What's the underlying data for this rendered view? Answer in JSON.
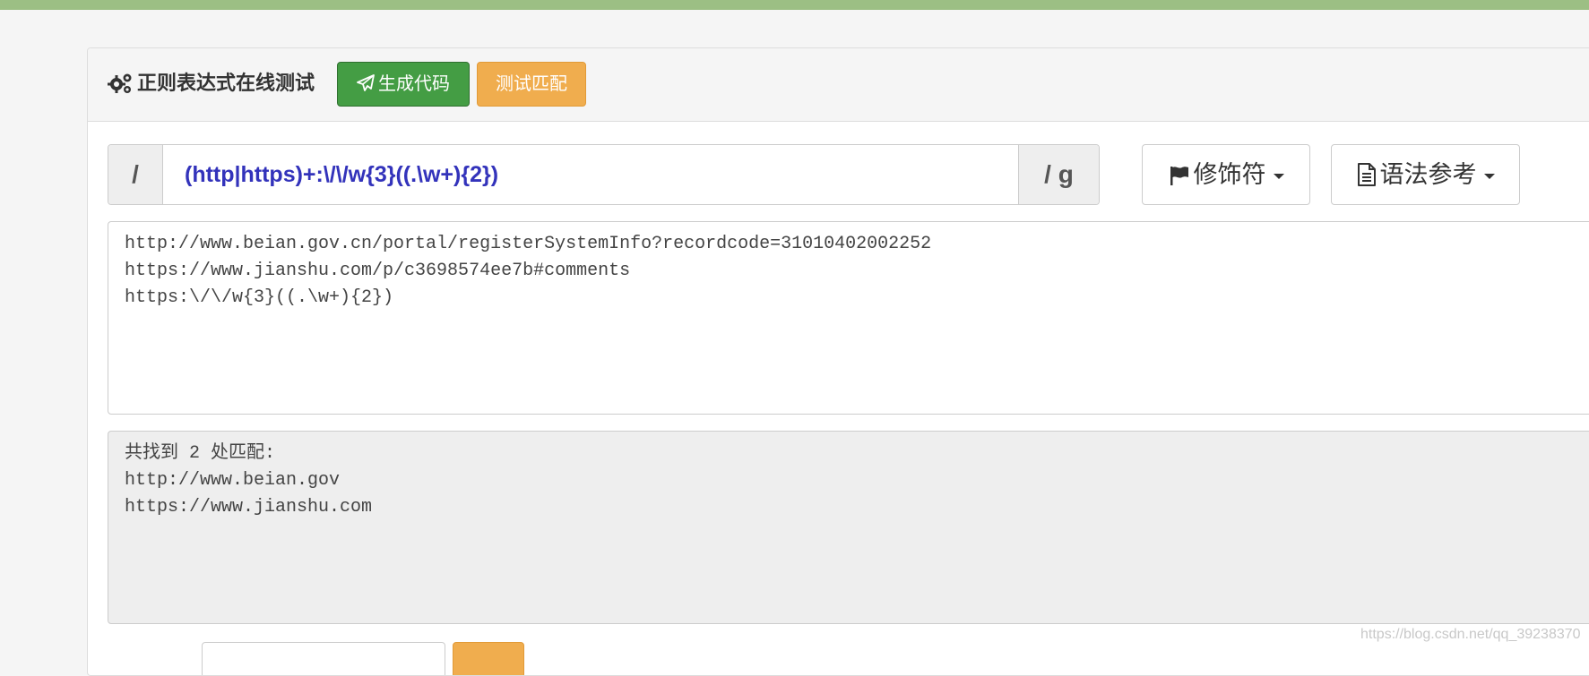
{
  "header": {
    "title": "正则表达式在线测试",
    "icon": "gears-icon",
    "generate_button": "生成代码",
    "generate_icon": "paper-plane-icon",
    "test_button": "测试匹配"
  },
  "regex": {
    "prefix": "/",
    "pattern": "(http|https)+:\\/\\/w{3}((.\\w+){2})",
    "suffix": "/ g"
  },
  "dropdowns": {
    "modifier_label": "修饰符",
    "modifier_icon": "flag-icon",
    "syntax_label": "语法参考",
    "syntax_icon": "file-text-icon"
  },
  "source_text": "http://www.beian.gov.cn/portal/registerSystemInfo?recordcode=31010402002252\nhttps://www.jianshu.com/p/c3698574ee7b#comments\nhttps:\\/\\/w{3}((.\\w+){2})",
  "result_text": "共找到 2 处匹配:\nhttp://www.beian.gov\nhttps://www.jianshu.com",
  "watermark": "https://blog.csdn.net/qq_39238370",
  "colors": {
    "top_bar": "#9cbf84",
    "success": "#449d44",
    "warning": "#f0ad4e",
    "regex_text": "#3333bb"
  }
}
